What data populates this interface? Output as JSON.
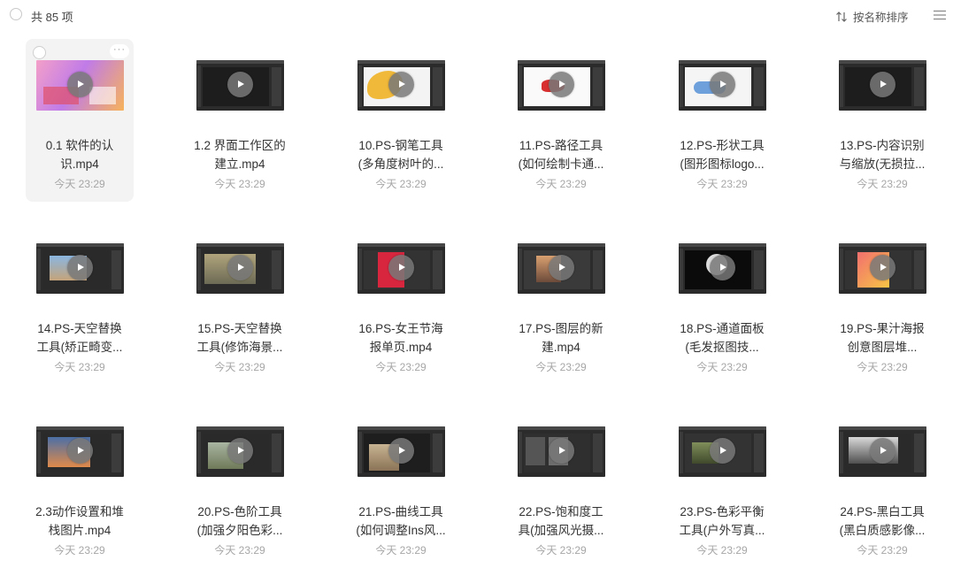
{
  "header": {
    "count_label": "共 85 项",
    "sort_label": "按名称排序",
    "select_all_icon": "circle-checkbox-icon",
    "sort_icon": "sort-arrows-icon",
    "view_icon": "list-view-icon"
  },
  "items": [
    {
      "line1": "0.1 软件的认",
      "line2": "识.mp4",
      "time": "今天 23:29",
      "thumb": "pink"
    },
    {
      "line1": "1.2 界面工作区的",
      "line2": "建立.mp4",
      "time": "今天 23:29",
      "thumb": "dark"
    },
    {
      "line1": "10.PS-钢笔工具",
      "line2": "(多角度树叶的...",
      "time": "今天 23:29",
      "thumb": "leaf"
    },
    {
      "line1": "11.PS-路径工具",
      "line2": "(如何绘制卡通...",
      "time": "今天 23:29",
      "thumb": "redshape"
    },
    {
      "line1": "12.PS-形状工具",
      "line2": "(图形图标logo...",
      "time": "今天 23:29",
      "thumb": "shape"
    },
    {
      "line1": "13.PS-内容识别",
      "line2": "与缩放(无损拉...",
      "time": "今天 23:29",
      "thumb": "dark"
    },
    {
      "line1": "14.PS-天空替换",
      "line2": "工具(矫正畸变...",
      "time": "今天 23:29",
      "thumb": "sky"
    },
    {
      "line1": "15.PS-天空替换",
      "line2": "工具(修饰海景...",
      "time": "今天 23:29",
      "thumb": "sea"
    },
    {
      "line1": "16.PS-女王节海",
      "line2": "报单页.mp4",
      "time": "今天 23:29",
      "thumb": "poster"
    },
    {
      "line1": "17.PS-图层的新",
      "line2": "建.mp4",
      "time": "今天 23:29",
      "thumb": "layers"
    },
    {
      "line1": "18.PS-通道面板",
      "line2": "(毛发抠图技...",
      "time": "今天 23:29",
      "thumb": "channel"
    },
    {
      "line1": "19.PS-果汁海报",
      "line2": "创意图层堆...",
      "time": "今天 23:29",
      "thumb": "juice"
    },
    {
      "line1": "2.3动作设置和堆",
      "line2": "栈图片.mp4",
      "time": "今天 23:29",
      "thumb": "sunset"
    },
    {
      "line1": "20.PS-色阶工具",
      "line2": "(加强夕阳色彩...",
      "time": "今天 23:29",
      "thumb": "road"
    },
    {
      "line1": "21.PS-曲线工具",
      "line2": "(如何调整Ins风...",
      "time": "今天 23:29",
      "thumb": "ins"
    },
    {
      "line1": "22.PS-饱和度工",
      "line2": "具(加强风光摄...",
      "time": "今天 23:29",
      "thumb": "split"
    },
    {
      "line1": "23.PS-色彩平衡",
      "line2": "工具(户外写真...",
      "time": "今天 23:29",
      "thumb": "outdoor"
    },
    {
      "line1": "24.PS-黑白工具",
      "line2": "(黑白质感影像...",
      "time": "今天 23:29",
      "thumb": "bw"
    }
  ],
  "selected_index": 0,
  "more_label": "···"
}
